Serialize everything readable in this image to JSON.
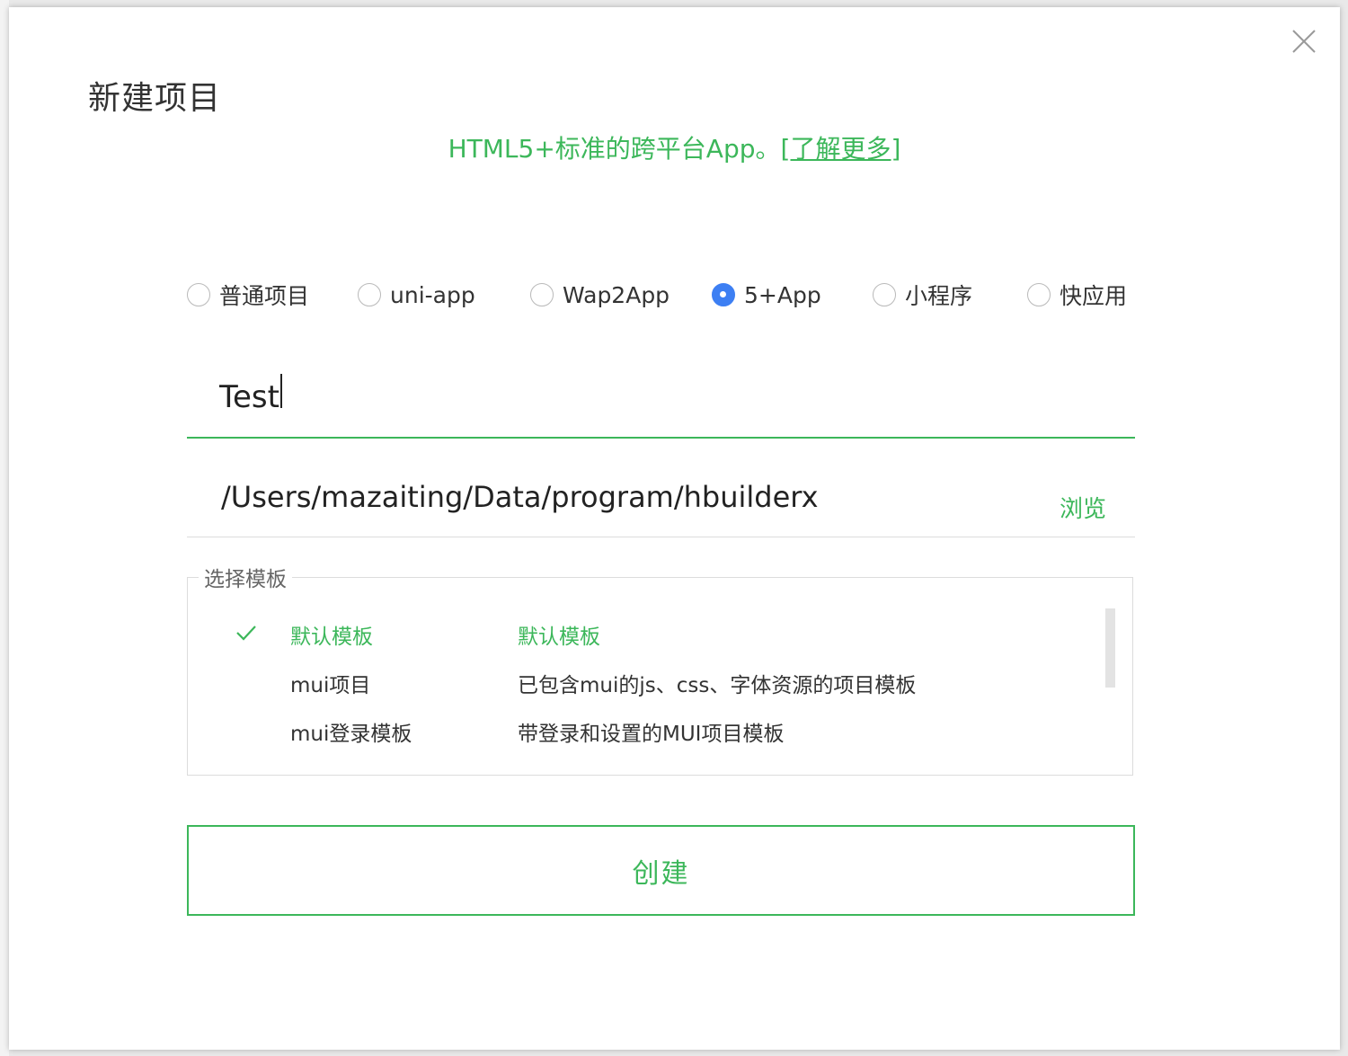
{
  "dialog": {
    "title": "新建项目",
    "subtitle_text": "HTML5+标准的跨平台App。",
    "learn_more_link": "[了解更多]"
  },
  "project_types": [
    {
      "label": "普通项目",
      "checked": false
    },
    {
      "label": "uni-app",
      "checked": false
    },
    {
      "label": "Wap2App",
      "checked": false
    },
    {
      "label": "5+App",
      "checked": true
    },
    {
      "label": "小程序",
      "checked": false
    },
    {
      "label": "快应用",
      "checked": false
    }
  ],
  "project_name": {
    "value": "Test"
  },
  "location": {
    "path": "/Users/mazaiting/Data/program/hbuilderx",
    "browse_label": "浏览"
  },
  "templates": {
    "legend": "选择模板",
    "items": [
      {
        "name": "默认模板",
        "description": "默认模板",
        "selected": true
      },
      {
        "name": "mui项目",
        "description": "已包含mui的js、css、字体资源的项目模板",
        "selected": false
      },
      {
        "name": "mui登录模板",
        "description": "带登录和设置的MUI项目模板",
        "selected": false
      }
    ]
  },
  "create_button": {
    "label": "创建"
  },
  "colors": {
    "accent_green": "#3cb75a",
    "radio_blue": "#3d7ff3"
  }
}
